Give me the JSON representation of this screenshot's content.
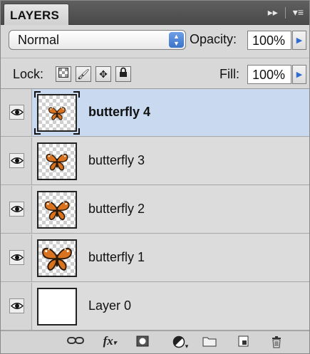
{
  "panel": {
    "tab_label": "LAYERS",
    "blend_mode": "Normal",
    "opacity_label": "Opacity:",
    "opacity_value": "100%",
    "lock_label": "Lock:",
    "fill_label": "Fill:",
    "fill_value": "100%"
  },
  "layers": [
    {
      "name": "butterfly 4",
      "selected": true,
      "thumb": "butterfly"
    },
    {
      "name": "butterfly 3",
      "selected": false,
      "thumb": "butterfly"
    },
    {
      "name": "butterfly 2",
      "selected": false,
      "thumb": "butterfly"
    },
    {
      "name": "butterfly 1",
      "selected": false,
      "thumb": "butterfly"
    },
    {
      "name": "Layer 0",
      "selected": false,
      "thumb": "white"
    }
  ],
  "toolbar": {
    "fx_label": "fx"
  },
  "colors": {
    "selected_row": "#c8d9f0",
    "accent_blue": "#3a73c9",
    "butterfly_orange": "#d9731f"
  }
}
